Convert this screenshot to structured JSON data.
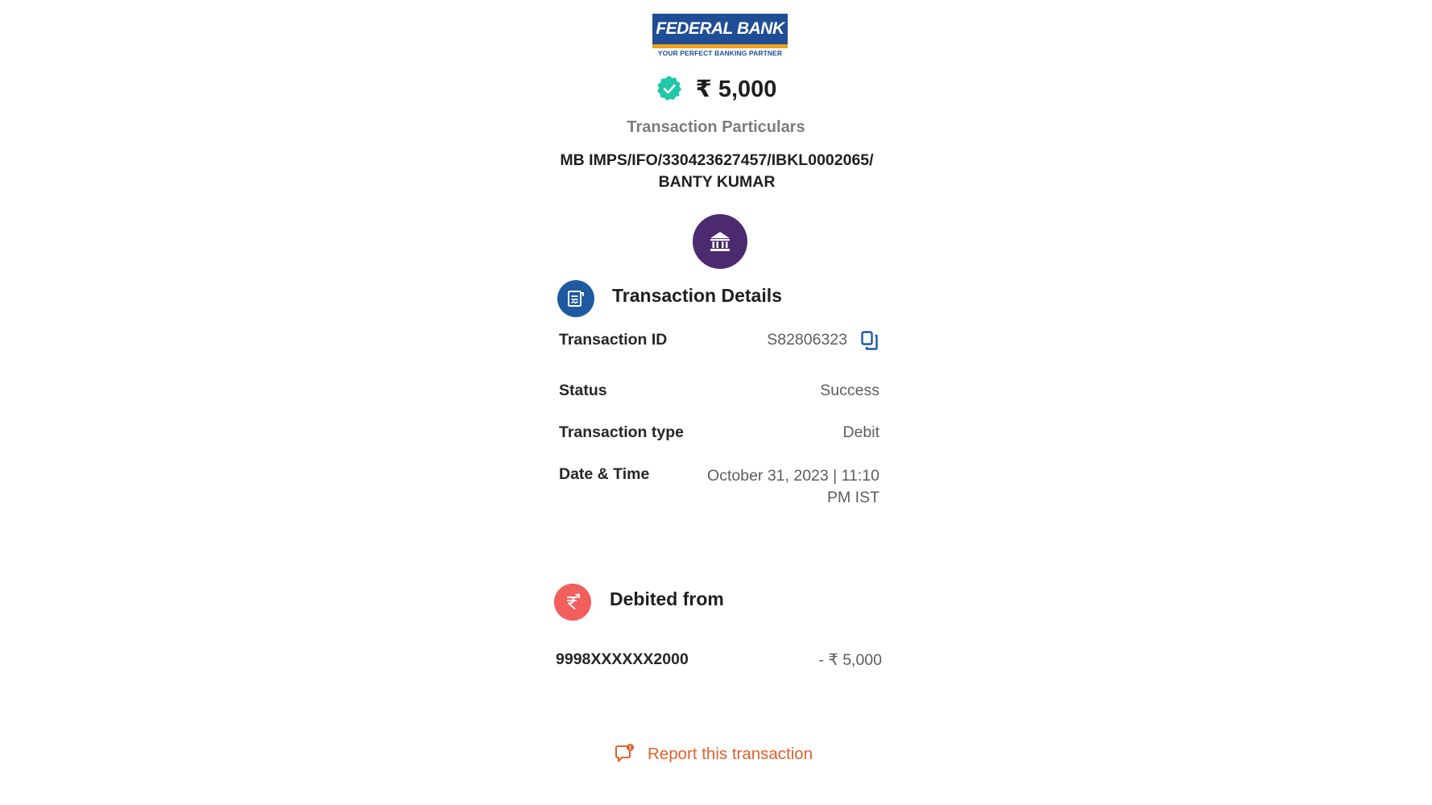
{
  "logo": {
    "name": "FEDERAL BANK",
    "tagline": "YOUR PERFECT BANKING PARTNER"
  },
  "amount": "₹ 5,000",
  "particulars": {
    "title": "Transaction Particulars",
    "line1": "MB IMPS/IFO/330423627457/IBKL0002065/",
    "line2": "BANTY KUMAR"
  },
  "details": {
    "title": "Transaction Details",
    "rows": [
      {
        "label": "Transaction ID",
        "value": "S82806323"
      },
      {
        "label": "Status",
        "value": "Success"
      },
      {
        "label": "Transaction type",
        "value": "Debit"
      },
      {
        "label": "Date & Time",
        "value_line1": "October 31, 2023 | 11:10",
        "value_line2": "PM IST"
      }
    ]
  },
  "debited": {
    "title": "Debited from",
    "account": "9998XXXXXX2000",
    "amount": "- ₹ 5,000"
  },
  "report_label": "Report this transaction",
  "colors": {
    "brand_blue": "#1f4e96",
    "brand_orange": "#f0a21c",
    "success_teal": "#1fc8a6",
    "bank_purple": "#4c2a70",
    "details_blue": "#1d5aa0",
    "debit_red": "#f25f5c",
    "report_orange": "#e2612b"
  },
  "icons": [
    "check-circle-icon",
    "bank-building-icon",
    "receipt-icon",
    "copy-icon",
    "rupee-transfer-icon",
    "report-chat-icon"
  ]
}
